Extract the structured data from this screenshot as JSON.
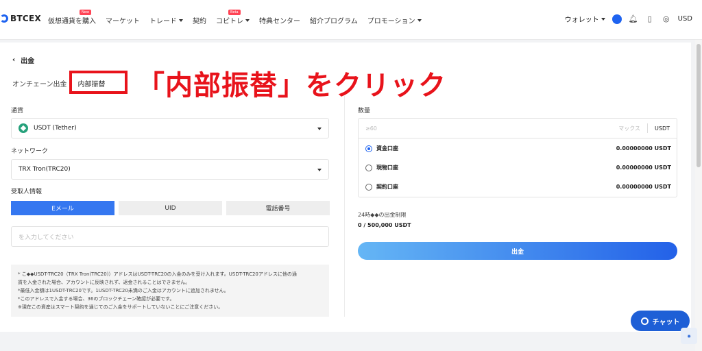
{
  "header": {
    "logo": "BTCEX",
    "nav": [
      {
        "label": "仮想通貨を購入",
        "badge": "New",
        "dropdown": false
      },
      {
        "label": "マーケット",
        "badge": "",
        "dropdown": false
      },
      {
        "label": "トレード",
        "badge": "",
        "dropdown": true
      },
      {
        "label": "契約",
        "badge": "",
        "dropdown": false
      },
      {
        "label": "コピトレ",
        "badge": "Beta",
        "dropdown": true
      },
      {
        "label": "特典センター",
        "badge": "",
        "dropdown": false
      },
      {
        "label": "紹介プログラム",
        "badge": "",
        "dropdown": false
      },
      {
        "label": "プロモーション",
        "badge": "",
        "dropdown": true
      }
    ],
    "wallet": "ウォレット",
    "currency": "USD"
  },
  "page": {
    "back_title": "出金",
    "mode_onchain": "オンチェーン出金",
    "mode_internal": "内部振替",
    "annotation": "「内部振替」をクリック"
  },
  "form": {
    "currency_label": "通貨",
    "currency_value": "USDT (Tether)",
    "network_label": "ネットワーク",
    "network_value": "TRX Tron(TRC20)",
    "recipient_label": "受取人情報",
    "tabs": [
      "Eメール",
      "UID",
      "電話番号"
    ],
    "recipient_placeholder": "を入力してください",
    "notes": [
      "* こ◆◆USDT-TRC20（TRX Tron(TRC20)）アドレスはUSDT-TRC20の入金のみを受け入れます。USDT-TRC20アドレスに他の通",
      "貨を入金された場合、アカウントに反映されず、返金されることはできません。",
      "*最低入金額は1USDT-TRC20です。1USDT-TRC20未満のご入金はアカウントに追加されません。",
      "*このアドレスで入金する場合、36のブロックチェーン確認が必要です。",
      "※現在この資産はスマート契約を通じてのご入金をサポートしていないことにご注意ください。"
    ]
  },
  "amount": {
    "label": "数量",
    "placeholder": "≥60",
    "max": "マックス",
    "unit": "USDT",
    "accounts": [
      {
        "name": "資金口座",
        "balance": "0.00000000 USDT",
        "selected": true
      },
      {
        "name": "現物口座",
        "balance": "0.00000000 USDT",
        "selected": false
      },
      {
        "name": "契約口座",
        "balance": "0.00000000 USDT",
        "selected": false
      }
    ],
    "limit_label": "24時◆◆の出金制限",
    "limit_value": "0 / 500,000 USDT",
    "submit": "出金"
  },
  "chat": {
    "label": "チャット"
  },
  "colors": {
    "accent": "#1e63f0",
    "annotation": "#e8131b"
  }
}
